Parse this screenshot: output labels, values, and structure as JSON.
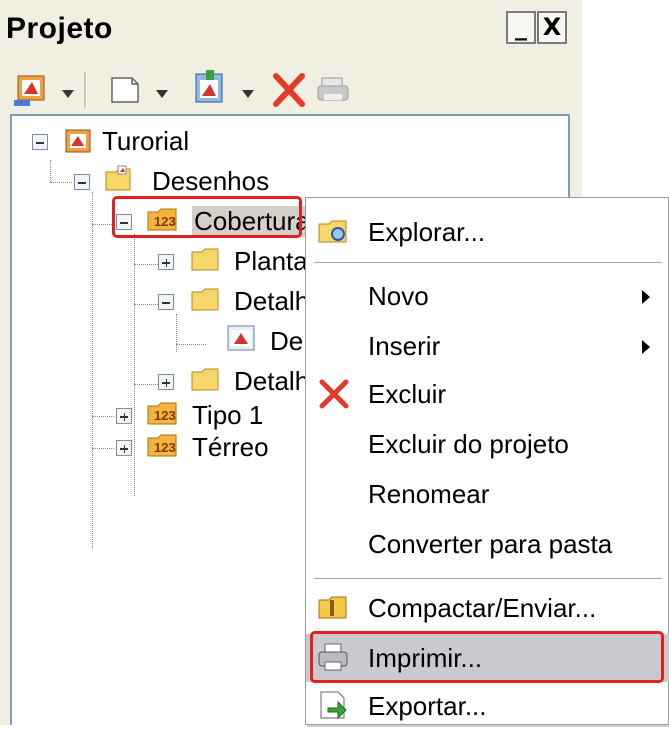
{
  "panel": {
    "title": "Projeto",
    "minimize_label": "_",
    "close_label": "X"
  },
  "toolbar": {
    "items": [
      {
        "icon": "project-icon",
        "has_dropdown": true
      },
      {
        "icon": "new-document-icon",
        "has_dropdown": true
      },
      {
        "icon": "insert-drawing-icon",
        "has_dropdown": true
      },
      {
        "icon": "delete-icon",
        "has_dropdown": false
      },
      {
        "icon": "print-icon",
        "has_dropdown": false
      }
    ]
  },
  "tree": {
    "root": "Turorial",
    "desenhos": "Desenhos",
    "cobertura": "Cobertura",
    "planta": "Planta",
    "detalh1": "Detalh",
    "de": "De",
    "detalh2": "Detalh",
    "tipo1": "Tipo 1",
    "terreo": "Térreo"
  },
  "menu": {
    "items": [
      {
        "label": "Explorar...",
        "icon": "folder-explore-icon",
        "submenu": false
      },
      {
        "label": "Novo",
        "submenu": true
      },
      {
        "label": "Inserir",
        "submenu": true
      },
      {
        "label": "Excluir",
        "icon": "delete-x-icon",
        "submenu": false
      },
      {
        "label": "Excluir do projeto",
        "submenu": false
      },
      {
        "label": "Renomear",
        "submenu": false
      },
      {
        "label": "Converter para pasta",
        "submenu": false
      },
      {
        "label": "Compactar/Enviar...",
        "icon": "compress-folder-icon",
        "submenu": false
      },
      {
        "label": "Imprimir...",
        "icon": "printer-icon",
        "submenu": false,
        "highlighted": true
      },
      {
        "label": "Exportar...",
        "icon": "export-icon",
        "submenu": false
      }
    ]
  },
  "colors": {
    "highlight_red": "#e1201f",
    "panel_bg": "#f1efe2",
    "menu_selection": "#c9c9cf",
    "delete_red": "#e33a2a"
  }
}
